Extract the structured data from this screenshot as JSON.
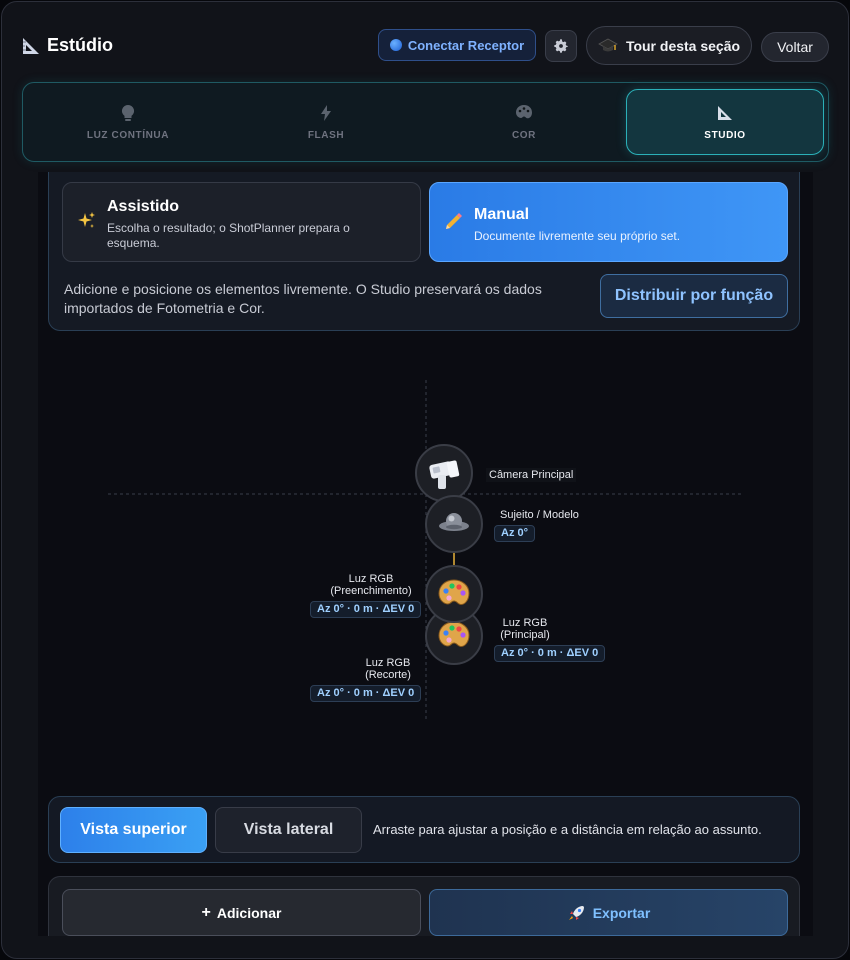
{
  "header": {
    "title": "Estúdio",
    "connect_label": "Conectar Receptor",
    "tour_label": "Tour desta seção",
    "back_label": "Voltar"
  },
  "tabs": [
    {
      "label": "LUZ CONTÍNUA",
      "icon": "bulb-icon",
      "active": false
    },
    {
      "label": "FLASH",
      "icon": "bolt-icon",
      "active": false
    },
    {
      "label": "COR",
      "icon": "palette-icon",
      "active": false
    },
    {
      "label": "STUDIO",
      "icon": "triangle-ruler-icon",
      "active": true
    }
  ],
  "mode": {
    "assisted": {
      "title": "Assistido",
      "desc": "Escolha o resultado; o ShotPlanner prepara o esquema.",
      "icon": "sparkles-icon"
    },
    "manual": {
      "title": "Manual",
      "desc": "Documente livremente seu próprio set.",
      "icon": "pencil-icon"
    },
    "description": "Adicione e posicione os elementos livremente. O Studio preservará os dados importados de Fotometria e Cor.",
    "distribute_label": "Distribuir por função"
  },
  "diagram": {
    "camera": {
      "label": "Câmera Principal",
      "icon": "camera-icon"
    },
    "subject": {
      "label": "Sujeito / Modelo",
      "tag": "Az 0°",
      "icon": "subject-icon"
    },
    "fill": {
      "label1": "Luz RGB",
      "label2": "(Preenchimento)",
      "tag": "Az 0° · 0 m · ΔEV 0",
      "icon": "palette-icon"
    },
    "key": {
      "label1": "Luz RGB",
      "label2": "(Principal)",
      "tag": "Az 0° · 0 m · ΔEV 0",
      "icon": "palette-icon"
    },
    "rim": {
      "label1": "Luz RGB",
      "label2": "(Recorte)",
      "tag": "Az 0° · 0 m · ΔEV 0",
      "icon": "palette-icon"
    }
  },
  "view": {
    "top_label": "Vista superior",
    "side_label": "Vista lateral",
    "hint": "Arraste para ajustar a posição e a distância em relação ao assunto."
  },
  "actions": {
    "add_label": "Adicionar",
    "export_label": "Exportar"
  },
  "colors": {
    "accent": "#2bb0b8",
    "primary": "#3f96f6"
  }
}
